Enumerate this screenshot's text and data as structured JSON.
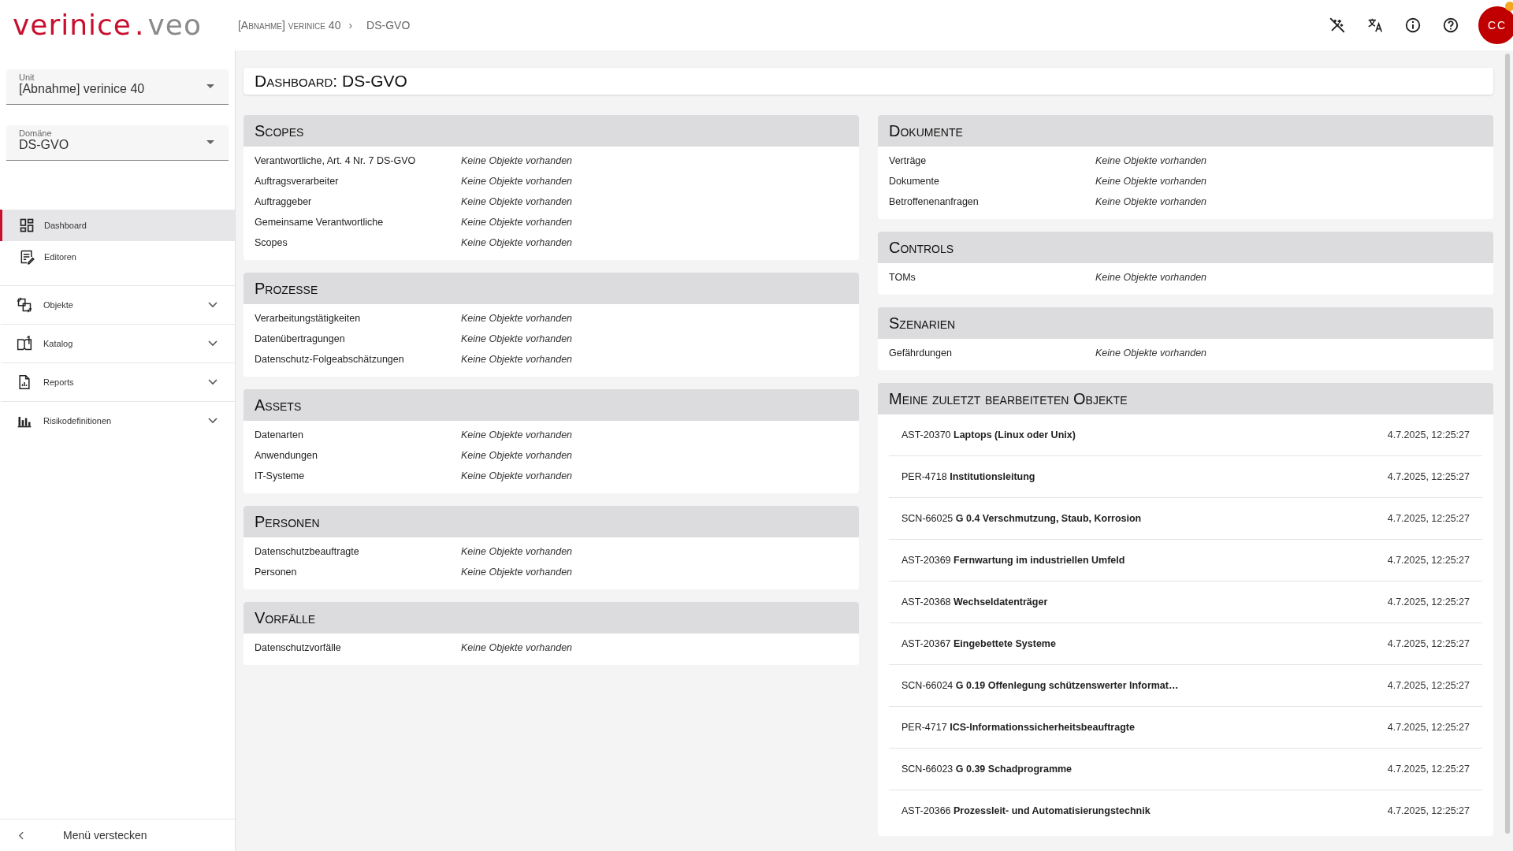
{
  "logo": {
    "main": "verinice",
    "dot": ".",
    "suffix": "veo"
  },
  "breadcrumb": [
    "[Abnahme] verinice 40",
    "DS-GVO"
  ],
  "breadcrumb_separator": "›",
  "toolbar": {
    "avatar": "CC",
    "avatar_badge": true
  },
  "sidebar": {
    "fields": [
      {
        "label": "Unit",
        "value": "[Abnahme] verinice 40"
      },
      {
        "label": "Domäne",
        "value": "DS-GVO"
      }
    ],
    "items": [
      {
        "label": "Dashboard",
        "kind": "link",
        "selected": true
      },
      {
        "label": "Editoren",
        "kind": "link",
        "selected": false
      },
      {
        "label": "Objekte",
        "kind": "group",
        "expanded": false,
        "selected": false
      },
      {
        "label": "Katalog",
        "kind": "group",
        "expanded": false,
        "selected": false
      },
      {
        "label": "Reports",
        "kind": "group",
        "expanded": false,
        "selected": false
      },
      {
        "label": "Risikodefinitionen",
        "kind": "group",
        "expanded": false,
        "selected": false
      }
    ],
    "hide_menu": "Menü verstecken"
  },
  "page_title": "Dashboard: DS-GVO",
  "left_sections": [
    {
      "title": "Scopes",
      "rows": [
        {
          "label": "Verantwortliche, Art. 4 Nr. 7 DS-GVO",
          "value": "Keine Objekte vorhanden"
        },
        {
          "label": "Auftragsverarbeiter",
          "value": "Keine Objekte vorhanden"
        },
        {
          "label": "Auftraggeber",
          "value": "Keine Objekte vorhanden"
        },
        {
          "label": "Gemeinsame Verantwortliche",
          "value": "Keine Objekte vorhanden"
        },
        {
          "label": "Scopes",
          "value": "Keine Objekte vorhanden"
        }
      ]
    },
    {
      "title": "Prozesse",
      "rows": [
        {
          "label": "Verarbeitungstätigkeiten",
          "value": "Keine Objekte vorhanden"
        },
        {
          "label": "Datenübertragungen",
          "value": "Keine Objekte vorhanden"
        },
        {
          "label": "Datenschutz-Folgeabschätzungen",
          "value": "Keine Objekte vorhanden"
        }
      ]
    },
    {
      "title": "Assets",
      "rows": [
        {
          "label": "Datenarten",
          "value": "Keine Objekte vorhanden"
        },
        {
          "label": "Anwendungen",
          "value": "Keine Objekte vorhanden"
        },
        {
          "label": "IT-Systeme",
          "value": "Keine Objekte vorhanden"
        }
      ]
    },
    {
      "title": "Personen",
      "rows": [
        {
          "label": "Datenschutzbeauftragte",
          "value": "Keine Objekte vorhanden"
        },
        {
          "label": "Personen",
          "value": "Keine Objekte vorhanden"
        }
      ]
    },
    {
      "title": "Vorfälle",
      "rows": [
        {
          "label": "Datenschutzvorfälle",
          "value": "Keine Objekte vorhanden"
        }
      ]
    }
  ],
  "right_sections": [
    {
      "title": "Dokumente",
      "rows": [
        {
          "label": "Verträge",
          "value": "Keine Objekte vorhanden"
        },
        {
          "label": "Dokumente",
          "value": "Keine Objekte vorhanden"
        },
        {
          "label": "Betroffenenanfragen",
          "value": "Keine Objekte vorhanden"
        }
      ]
    },
    {
      "title": "Controls",
      "rows": [
        {
          "label": "TOMs",
          "value": "Keine Objekte vorhanden"
        }
      ]
    },
    {
      "title": "Szenarien",
      "rows": [
        {
          "label": "Gefährdungen",
          "value": "Keine Objekte vorhanden"
        }
      ]
    }
  ],
  "recent": {
    "title": "Meine zuletzt bearbeiteten Objekte",
    "items": [
      {
        "text": "AST-20370 **Laptops (Linux oder Unix)**",
        "time": "4.7.2025, 12:25:27"
      },
      {
        "text": "PER-4718 **Institutionsleitung**",
        "time": "4.7.2025, 12:25:27"
      },
      {
        "text": "SCN-66025 **G 0.4 Verschmutzung, Staub, Korrosion**",
        "time": "4.7.2025, 12:25:27"
      },
      {
        "text": "AST-20369 **Fernwartung im industriellen Umfeld**",
        "time": "4.7.2025, 12:25:27"
      },
      {
        "text": "AST-20368 **Wechseldatenträger**",
        "time": "4.7.2025, 12:25:27"
      },
      {
        "text": "AST-20367 **Eingebettete Systeme**",
        "time": "4.7.2025, 12:25:27"
      },
      {
        "text": "SCN-66024 **G 0.19 Offenlegung schützenswerter Informat…**",
        "time": "4.7.2025, 12:25:27"
      },
      {
        "text": "PER-4717 **ICS-Informationssicherheitsbeauftragte**",
        "time": "4.7.2025, 12:25:27"
      },
      {
        "text": "SCN-66023 **G 0.39 Schadprogramme**",
        "time": "4.7.2025, 12:25:27"
      },
      {
        "text": "AST-20366 **Prozessleit- und Automatisierungstechnik**",
        "time": "4.7.2025, 12:25:27"
      }
    ]
  }
}
